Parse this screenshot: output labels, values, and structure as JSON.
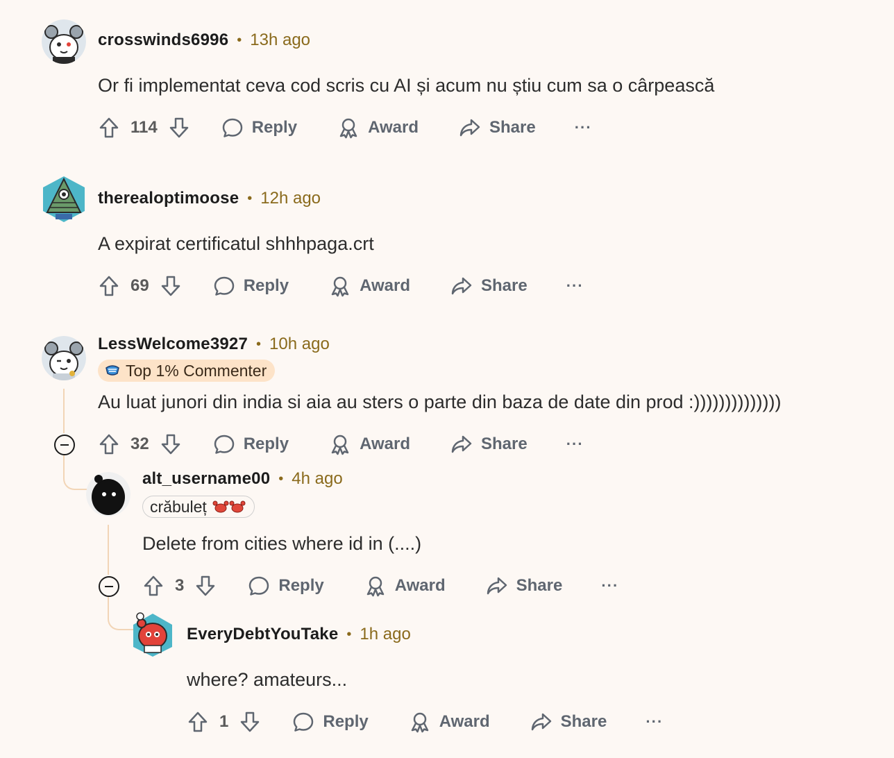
{
  "actions": {
    "reply": "Reply",
    "award": "Award",
    "share": "Share",
    "more": "···"
  },
  "comments": [
    {
      "username": "crosswinds6996",
      "time": "13h ago",
      "body": "Or fi implementat ceva cod scris cu AI și acum nu știu cum sa o cârpească",
      "score": "114",
      "avatar": "snoo-mouse-ears-avatar"
    },
    {
      "username": "therealoptimoose",
      "time": "12h ago",
      "body": "A expirat certificatul shhhpaga.crt",
      "score": "69",
      "avatar": "pyramid-eye-avatar"
    },
    {
      "username": "LessWelcome3927",
      "time": "10h ago",
      "flair": "Top 1% Commenter",
      "flair_icon": "commenter-badge-icon",
      "body": "Au luat junori din india si aia au sters o parte din baza de date din prod :))))))))))))))",
      "score": "32",
      "avatar": "snoo-mouse-ears-avatar"
    },
    {
      "username": "alt_username00",
      "time": "4h ago",
      "flair": "crăbuleț",
      "flair_icon": "crab-emoji-icon",
      "body": "Delete from cities where id in (....)",
      "score": "3",
      "avatar": "black-silhouette-avatar"
    },
    {
      "username": "EveryDebtYouTake",
      "time": "1h ago",
      "body": "where? amateurs...",
      "score": "1",
      "avatar": "red-snoo-avatar"
    }
  ]
}
